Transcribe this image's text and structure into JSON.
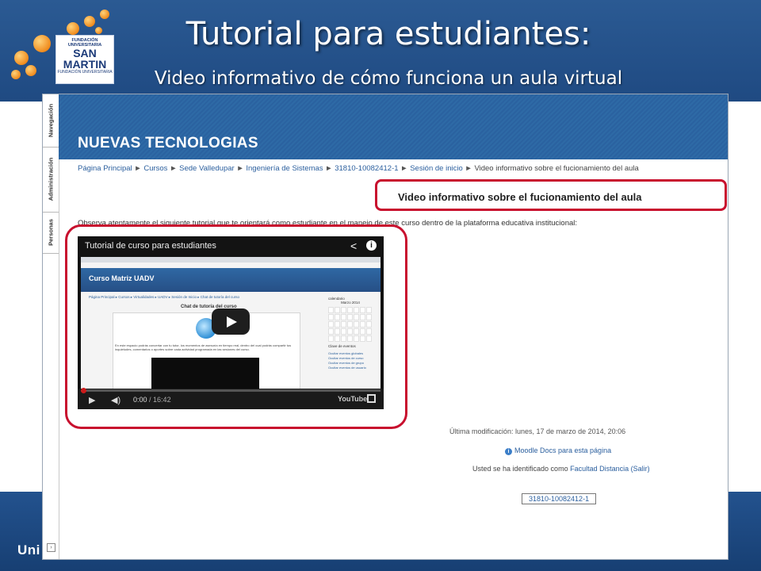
{
  "slide": {
    "title": "Tutorial para estudiantes:",
    "subtitle": "Video informativo de cómo funciona un aula virtual",
    "footer_text": "Uni",
    "logo": {
      "line1": "FUNDACIÓN UNIVERSITARIA",
      "line2": "SAN MARTIN",
      "line3": "FUNDACIÓN UNIVERSITARIA"
    }
  },
  "side_tabs": [
    "Navegación",
    "Administración",
    "Personas"
  ],
  "site": {
    "title": "NUEVAS TECNOLOGIAS",
    "breadcrumb": [
      "Página Principal",
      "Cursos",
      "Sede Valledupar",
      "Ingeniería de Sistemas",
      "31810-10082412-1",
      "Sesión de inicio",
      "Video informativo sobre el fucionamiento del aula"
    ],
    "breadcrumb_sep": "►",
    "page_heading": "Video informativo sobre el fucionamiento del aula",
    "intro": "Observa atentamente el siguiente tutorial que te orientará como estudiante en el manejo de este curso dentro de la plataforma educativa institucional:"
  },
  "video": {
    "title": "Tutorial de curso para estudiantes",
    "current_time": "0:00",
    "duration": "/ 16:42",
    "youtube_label": "YouTube",
    "progress": 0.0,
    "inner": {
      "site_title": "Curso Matriz UADV",
      "breadcrumb": "Página Principal ▸ Cursos ▸ Virtualidades ▸ UADV ▸ Sesión de Inicio ▸ Chat de tutoría del curso",
      "chat_title": "Chat de tutoría del curso",
      "text": "En este espacio podrás concertar con tu tutor, los momentos de asesoría en tiempo real, dentro del cual podrás compartir tus inquietudes, comentarios o aportes sobre cada actividad programada en las sesiones del curso.",
      "calendar_title": "calendario",
      "calendar_month": "Marzo 2014",
      "events_title": "Clave de eventos",
      "events": [
        "Ocultar eventos globales",
        "Ocultar eventos de curso",
        "Ocultar eventos de grupo",
        "Ocultar eventos de usuario"
      ]
    }
  },
  "footer_info": {
    "last_modified": "Última modificación: lunes, 17 de marzo de 2014, 20:06",
    "moodle_docs": "Moodle Docs para esta página",
    "logged_prefix": "Usted se ha identificado como ",
    "user_name": "Facultad Distancia",
    "logout": "(Salir)",
    "course_code": "31810-10082412-1"
  },
  "colors": {
    "slide_blue": "#1f4a82",
    "site_header_blue": "#2e6aa6",
    "highlight_red": "#c8102e",
    "link_blue": "#2b5f9e"
  },
  "icons": {
    "share": "share-icon",
    "info": "info-icon",
    "play": "play-icon",
    "volume": "volume-icon",
    "fullscreen": "fullscreen-icon"
  }
}
